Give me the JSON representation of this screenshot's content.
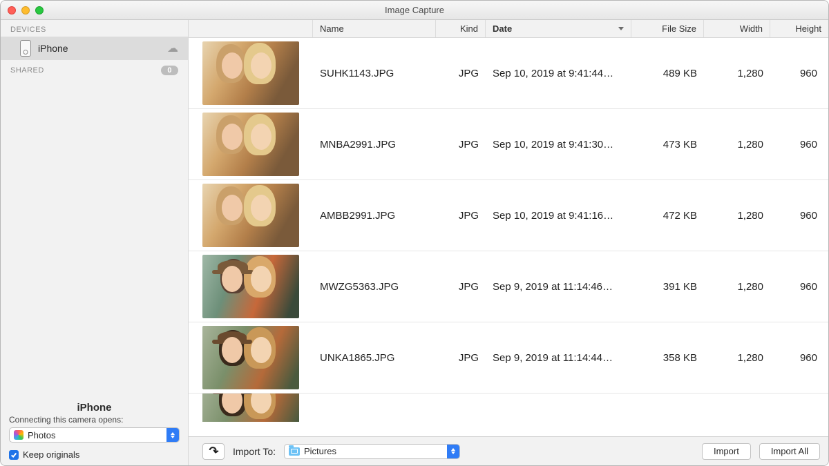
{
  "window": {
    "title": "Image Capture"
  },
  "sidebar": {
    "sections": {
      "devices_label": "DEVICES",
      "shared_label": "SHARED",
      "shared_count": "0"
    },
    "device_item": "iPhone",
    "bottom": {
      "device_name": "iPhone",
      "hint": "Connecting this camera opens:",
      "opens_select": "Photos",
      "keep_originals": "Keep originals"
    }
  },
  "columns": {
    "name": "Name",
    "kind": "Kind",
    "date": "Date",
    "size": "File Size",
    "width": "Width",
    "height": "Height"
  },
  "rows": [
    {
      "name": "SUHK1143.JPG",
      "kind": "JPG",
      "date": "Sep 10, 2019 at 9:41:44…",
      "size": "489 KB",
      "width": "1,280",
      "height": "960",
      "thumb": "a"
    },
    {
      "name": "MNBA2991.JPG",
      "kind": "JPG",
      "date": "Sep 10, 2019 at 9:41:30…",
      "size": "473 KB",
      "width": "1,280",
      "height": "960",
      "thumb": "a"
    },
    {
      "name": "AMBB2991.JPG",
      "kind": "JPG",
      "date": "Sep 10, 2019 at 9:41:16…",
      "size": "472 KB",
      "width": "1,280",
      "height": "960",
      "thumb": "a"
    },
    {
      "name": "MWZG5363.JPG",
      "kind": "JPG",
      "date": "Sep 9, 2019 at 11:14:46…",
      "size": "391 KB",
      "width": "1,280",
      "height": "960",
      "thumb": "b"
    },
    {
      "name": "UNKA1865.JPG",
      "kind": "JPG",
      "date": "Sep 9, 2019 at 11:14:44…",
      "size": "358 KB",
      "width": "1,280",
      "height": "960",
      "thumb": "c"
    }
  ],
  "toolbar": {
    "import_to_label": "Import To:",
    "import_to_value": "Pictures",
    "import": "Import",
    "import_all": "Import All"
  }
}
